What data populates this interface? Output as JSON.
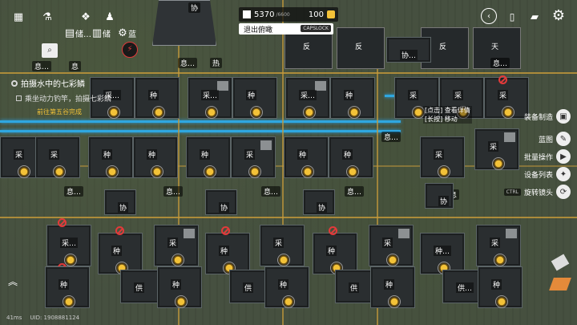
{
  "top_left": {
    "icons": [
      {
        "name": "map-icon",
        "glyph": "▦"
      },
      {
        "name": "lab-icon",
        "glyph": "⚗"
      },
      {
        "name": "network-icon",
        "glyph": "❖"
      },
      {
        "name": "robot-icon",
        "glyph": "♟"
      }
    ],
    "buttons": [
      {
        "label": "储…",
        "glyph": "▤"
      },
      {
        "label": "储",
        "glyph": "▥"
      },
      {
        "label": "蓝",
        "glyph": "⚙"
      }
    ]
  },
  "resources": {
    "currency": "5370",
    "currency_max": "/6600",
    "count": "100"
  },
  "exit_view": {
    "label": "退出俯瞰",
    "key": "CAPSLOCK"
  },
  "quest": {
    "title": "拍摄水中的七彩鳞",
    "item": "乘坐动力钓竿，拍摄七彩鳞",
    "sub": "前往第五谷完成"
  },
  "right_menu": [
    {
      "label": "装备制造",
      "key": "",
      "glyph": "▣"
    },
    {
      "label": "蓝图",
      "key": "",
      "glyph": "✎"
    },
    {
      "label": "批量操作",
      "key": "",
      "glyph": "▶"
    },
    {
      "label": "设备列表",
      "key": "",
      "glyph": "✦"
    },
    {
      "label": "旋转镜头",
      "key": "CTRL",
      "glyph": "⟳"
    }
  ],
  "center_tooltip": {
    "line1": "[点击] 查看详情",
    "line2": "[长按] 移动"
  },
  "status": {
    "ping": "41ms",
    "uid": "UID: 1908881124"
  },
  "building_labels": {
    "harvest": "采",
    "plant": "种",
    "supply": "供",
    "coop": "协",
    "reverse": "反",
    "heat": "热",
    "rest": "息",
    "sky": "天",
    "station": "站",
    "gather": "采…",
    "plant_more": "种…",
    "rest_more": "息…",
    "coop_more": "协…",
    "supply_more": "供…"
  },
  "colors": {
    "belt": "#2fa7e0",
    "accent": "#f3c238",
    "forbid": "#e23a3a"
  }
}
